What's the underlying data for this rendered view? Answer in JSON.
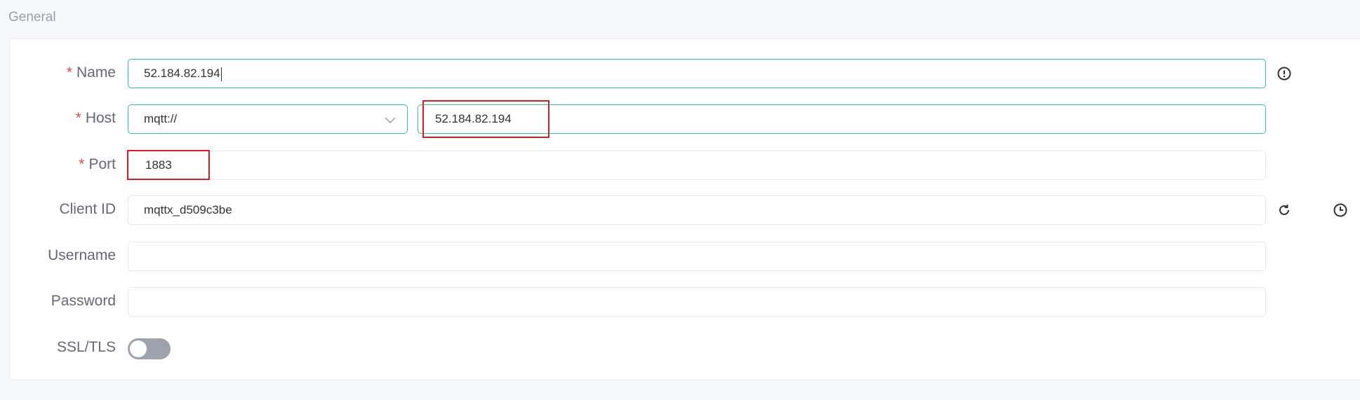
{
  "section": {
    "title": "General"
  },
  "form": {
    "name": {
      "label": "Name",
      "required": "*",
      "value": "52.184.82.194"
    },
    "host": {
      "label": "Host",
      "required": "*",
      "protocol": "mqtt://",
      "value": "52.184.82.194"
    },
    "port": {
      "label": "Port",
      "required": "*",
      "value": "1883"
    },
    "client_id": {
      "label": "Client ID",
      "value": "mqttx_d509c3be"
    },
    "username": {
      "label": "Username",
      "value": ""
    },
    "password": {
      "label": "Password",
      "value": ""
    },
    "ssl_tls": {
      "label": "SSL/TLS",
      "enabled": false
    }
  },
  "icons": {
    "name_info": "info-circle-icon",
    "client_id_refresh": "refresh-icon",
    "client_id_time": "clock-icon",
    "protocol_dropdown": "chevron-down-icon",
    "port_up": "chevron-up-icon",
    "port_down": "chevron-down-icon"
  },
  "colors": {
    "accent": "#34c388",
    "required": "#e5484d",
    "highlight": "#d51f27"
  }
}
